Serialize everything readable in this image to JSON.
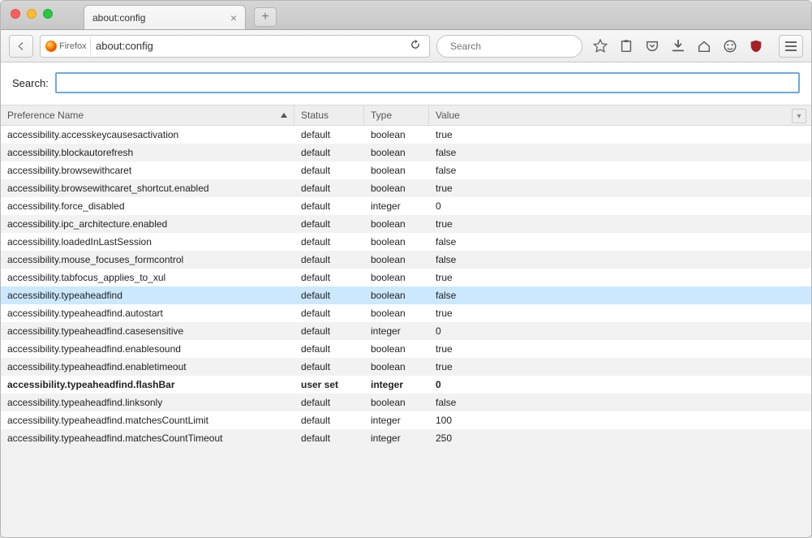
{
  "tab": {
    "title": "about:config"
  },
  "urlbar": {
    "brand": "Firefox",
    "url": "about:config"
  },
  "searchbar": {
    "placeholder": "Search"
  },
  "toolbar_icons": {
    "back": "back-icon",
    "reload": "reload-icon",
    "bookmark": "star-icon",
    "clipboard": "clipboard-icon",
    "pocket": "pocket-icon",
    "downloads": "download-icon",
    "home": "home-icon",
    "safemode": "face-icon",
    "ublock": "ublock-icon",
    "menu": "menu-icon"
  },
  "page": {
    "search_label": "Search:",
    "search_value": ""
  },
  "columns": {
    "name": "Preference Name",
    "status": "Status",
    "type": "Type",
    "value": "Value"
  },
  "rows": [
    {
      "name": "accessibility.accesskeycausesactivation",
      "status": "default",
      "type": "boolean",
      "value": "true"
    },
    {
      "name": "accessibility.blockautorefresh",
      "status": "default",
      "type": "boolean",
      "value": "false"
    },
    {
      "name": "accessibility.browsewithcaret",
      "status": "default",
      "type": "boolean",
      "value": "false"
    },
    {
      "name": "accessibility.browsewithcaret_shortcut.enabled",
      "status": "default",
      "type": "boolean",
      "value": "true"
    },
    {
      "name": "accessibility.force_disabled",
      "status": "default",
      "type": "integer",
      "value": "0"
    },
    {
      "name": "accessibility.ipc_architecture.enabled",
      "status": "default",
      "type": "boolean",
      "value": "true"
    },
    {
      "name": "accessibility.loadedInLastSession",
      "status": "default",
      "type": "boolean",
      "value": "false"
    },
    {
      "name": "accessibility.mouse_focuses_formcontrol",
      "status": "default",
      "type": "boolean",
      "value": "false"
    },
    {
      "name": "accessibility.tabfocus_applies_to_xul",
      "status": "default",
      "type": "boolean",
      "value": "true"
    },
    {
      "name": "accessibility.typeaheadfind",
      "status": "default",
      "type": "boolean",
      "value": "false",
      "selected": true
    },
    {
      "name": "accessibility.typeaheadfind.autostart",
      "status": "default",
      "type": "boolean",
      "value": "true"
    },
    {
      "name": "accessibility.typeaheadfind.casesensitive",
      "status": "default",
      "type": "integer",
      "value": "0"
    },
    {
      "name": "accessibility.typeaheadfind.enablesound",
      "status": "default",
      "type": "boolean",
      "value": "true"
    },
    {
      "name": "accessibility.typeaheadfind.enabletimeout",
      "status": "default",
      "type": "boolean",
      "value": "true"
    },
    {
      "name": "accessibility.typeaheadfind.flashBar",
      "status": "user set",
      "type": "integer",
      "value": "0",
      "bold": true
    },
    {
      "name": "accessibility.typeaheadfind.linksonly",
      "status": "default",
      "type": "boolean",
      "value": "false"
    },
    {
      "name": "accessibility.typeaheadfind.matchesCountLimit",
      "status": "default",
      "type": "integer",
      "value": "100"
    },
    {
      "name": "accessibility.typeaheadfind.matchesCountTimeout",
      "status": "default",
      "type": "integer",
      "value": "250"
    }
  ]
}
